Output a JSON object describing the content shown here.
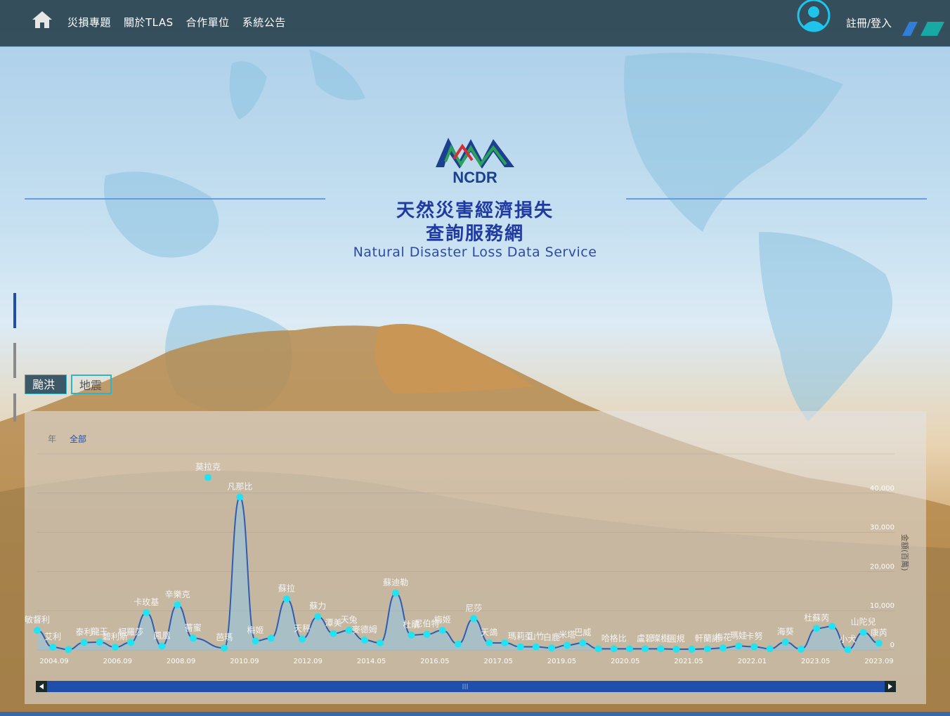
{
  "nav": {
    "items": [
      "災損專題",
      "關於TLAS",
      "合作單位",
      "系統公告"
    ],
    "login_label": "註冊/登入"
  },
  "hero": {
    "logo_text": "NCDR",
    "title_line1": "天然災害經濟損失",
    "title_line2": "查詢服務網",
    "subtitle": "Natural Disaster Loss Data Service"
  },
  "tabs": [
    {
      "label": "颱洪",
      "active": true
    },
    {
      "label": "地震",
      "active": false
    }
  ],
  "range": {
    "year_label": "年",
    "all_label": "全部"
  },
  "colors": {
    "line": "#2f5db0",
    "point": "#22e3f2",
    "area": "#8fc7e6",
    "scrollbar": "#1f4faa"
  },
  "chart_data": {
    "type": "area",
    "ylabel": "金額(百萬)",
    "yticks": [
      "0",
      "10,000",
      "20,000",
      "30,000",
      "40,000"
    ],
    "ylim": [
      0,
      50000
    ],
    "xticks": [
      "2004.09",
      "2006.09",
      "2008.09",
      "2010.09",
      "2012.09",
      "2014.05",
      "2016.05",
      "2017.05",
      "2019.05",
      "2020.05",
      "2021.05",
      "2022.01",
      "2023.05",
      "2023.09"
    ],
    "x_index_range": [
      0,
      55
    ],
    "points": [
      {
        "i": 0,
        "y": 5000,
        "label": "敏督利"
      },
      {
        "i": 1,
        "y": 700,
        "label": "艾利"
      },
      {
        "i": 2,
        "y": 100,
        "label": ""
      },
      {
        "i": 3,
        "y": 1900,
        "label": "泰利"
      },
      {
        "i": 4,
        "y": 2000,
        "label": "龍王"
      },
      {
        "i": 5,
        "y": 700,
        "label": "碧利斯"
      },
      {
        "i": 6,
        "y": 1900,
        "label": "柯羅莎"
      },
      {
        "i": 7,
        "y": 9500,
        "label": "卡玫基"
      },
      {
        "i": 8,
        "y": 1000,
        "label": "鳳凰"
      },
      {
        "i": 9,
        "y": 11500,
        "label": "辛樂克"
      },
      {
        "i": 10,
        "y": 3000,
        "label": "薔蜜"
      },
      {
        "i": 11,
        "y": 44000,
        "label": "莫拉克",
        "offset": true
      },
      {
        "i": 12,
        "y": 500,
        "label": "芭瑪"
      },
      {
        "i": 13,
        "y": 39000,
        "label": "凡那比"
      },
      {
        "i": 14,
        "y": 2300,
        "label": "梅姬"
      },
      {
        "i": 15,
        "y": 3000,
        "label": ""
      },
      {
        "i": 16,
        "y": 13000,
        "label": "蘇拉"
      },
      {
        "i": 17,
        "y": 2800,
        "label": "天秤"
      },
      {
        "i": 18,
        "y": 8500,
        "label": "蘇力"
      },
      {
        "i": 19,
        "y": 4200,
        "label": "潭美"
      },
      {
        "i": 20,
        "y": 5000,
        "label": "天兔"
      },
      {
        "i": 21,
        "y": 2500,
        "label": "麥德姆"
      },
      {
        "i": 22,
        "y": 1800,
        "label": ""
      },
      {
        "i": 23,
        "y": 14500,
        "label": "蘇迪勒"
      },
      {
        "i": 24,
        "y": 3800,
        "label": "杜鵑"
      },
      {
        "i": 25,
        "y": 4000,
        "label": "尼伯特"
      },
      {
        "i": 26,
        "y": 5000,
        "label": "梅姬"
      },
      {
        "i": 27,
        "y": 1500,
        "label": ""
      },
      {
        "i": 28,
        "y": 8000,
        "label": "尼莎"
      },
      {
        "i": 29,
        "y": 1800,
        "label": "天鴿"
      },
      {
        "i": 30,
        "y": 1800,
        "label": ""
      },
      {
        "i": 31,
        "y": 800,
        "label": "瑪莉亞"
      },
      {
        "i": 32,
        "y": 800,
        "label": "山竹"
      },
      {
        "i": 33,
        "y": 500,
        "label": "白鹿"
      },
      {
        "i": 34,
        "y": 1200,
        "label": "米塔"
      },
      {
        "i": 35,
        "y": 1800,
        "label": "巴威"
      },
      {
        "i": 36,
        "y": 300,
        "label": ""
      },
      {
        "i": 37,
        "y": 300,
        "label": "哈格比"
      },
      {
        "i": 38,
        "y": 300,
        "label": ""
      },
      {
        "i": 39,
        "y": 300,
        "label": "盧碧"
      },
      {
        "i": 40,
        "y": 300,
        "label": "璨樹"
      },
      {
        "i": 41,
        "y": 200,
        "label": "圓規"
      },
      {
        "i": 42,
        "y": 200,
        "label": ""
      },
      {
        "i": 43,
        "y": 300,
        "label": "軒蘭諾"
      },
      {
        "i": 44,
        "y": 500,
        "label": "梅花"
      },
      {
        "i": 45,
        "y": 1000,
        "label": "瑪娃"
      },
      {
        "i": 46,
        "y": 800,
        "label": "卡努"
      },
      {
        "i": 47,
        "y": 300,
        "label": ""
      },
      {
        "i": 48,
        "y": 2000,
        "label": "海葵"
      },
      {
        "i": 49,
        "y": 200,
        "label": ""
      },
      {
        "i": 50,
        "y": 5500,
        "label": "杜蘇芮"
      },
      {
        "i": 51,
        "y": 6000,
        "label": ""
      },
      {
        "i": 52,
        "y": 100,
        "label": "小犬"
      },
      {
        "i": 53,
        "y": 4500,
        "label": "山陀兒"
      },
      {
        "i": 54,
        "y": 1700,
        "label": "康芮"
      }
    ]
  }
}
